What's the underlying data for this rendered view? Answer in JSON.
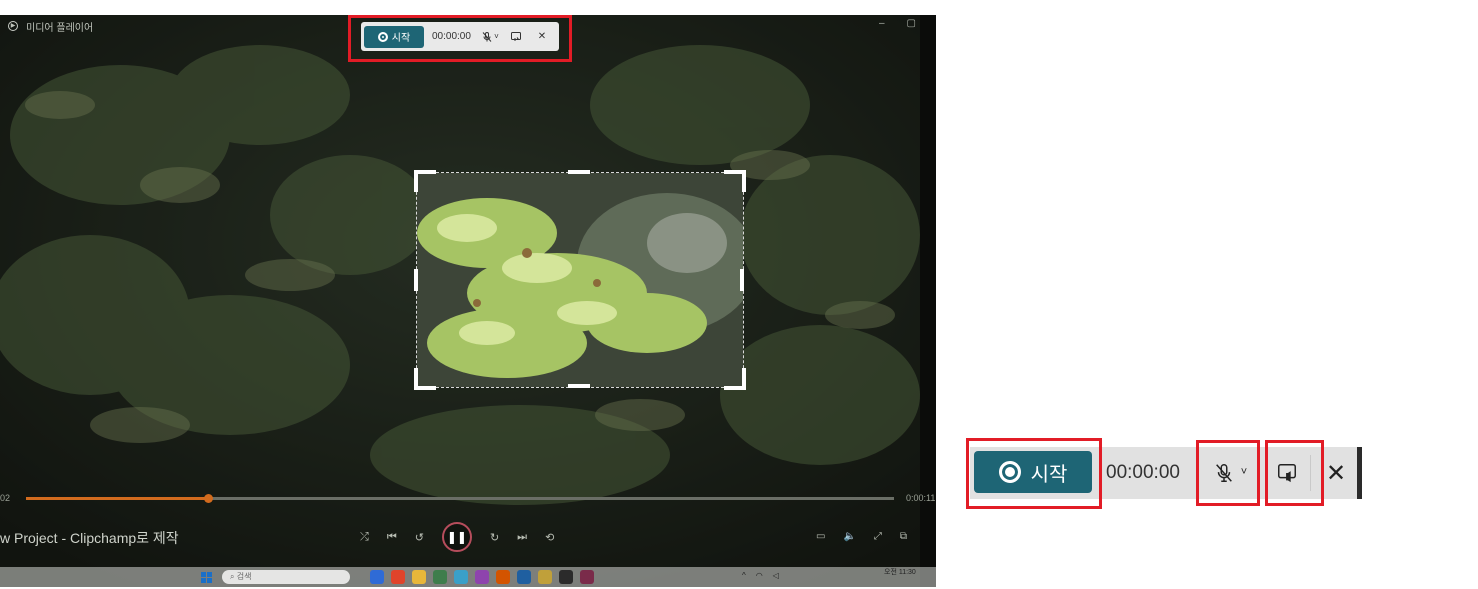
{
  "player": {
    "window_title": "미디어 플레이어",
    "video_title": "w Project - Clipchamp로 제작",
    "time_start": "02",
    "time_end": "0:00:11",
    "progress_fraction": 0.21
  },
  "mini_toolbar": {
    "start_label": "시작",
    "timer": "00:00:00"
  },
  "taskbar": {
    "search_placeholder": "검색",
    "clock_line1": "오전 11:30",
    "clock_line2": ""
  },
  "toolbar": {
    "start_label": "시작",
    "timer": "00:00:00",
    "close_glyph": "✕"
  },
  "colors": {
    "accent": "#1e6575",
    "highlight": "#e21c26",
    "toolbar_bg": "#e1e1e1",
    "seek_fill": "#d26b1e"
  },
  "icons": {
    "mic": "microphone-off-icon",
    "cast": "system-audio-icon",
    "close": "close-icon",
    "record": "record-dot-icon"
  }
}
